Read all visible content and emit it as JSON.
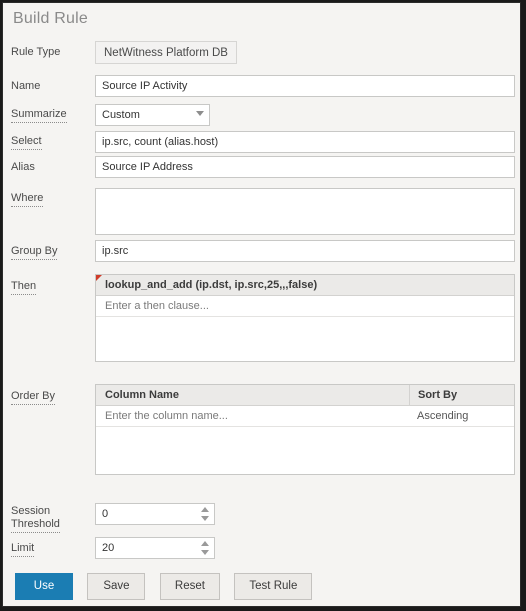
{
  "page": {
    "title": "Build Rule"
  },
  "form": {
    "rule_type": {
      "label": "Rule Type",
      "value": "NetWitness Platform DB"
    },
    "name": {
      "label": "Name",
      "value": "Source IP Activity",
      "placeholder": ""
    },
    "summarize": {
      "label": "Summarize",
      "value": "Custom",
      "options": [
        "Custom"
      ]
    },
    "select": {
      "label": "Select",
      "value": "ip.src, count (alias.host)",
      "placeholder": ""
    },
    "alias": {
      "label": "Alias",
      "value": "Source IP Address",
      "placeholder": ""
    },
    "where": {
      "label": "Where",
      "value": "",
      "placeholder": ""
    },
    "group_by": {
      "label": "Group By",
      "value": "ip.src",
      "placeholder": ""
    },
    "then": {
      "label": "Then",
      "entries": [
        {
          "text": "lookup_and_add (ip.dst, ip.src,25,,,false)",
          "type": "entry"
        }
      ],
      "placeholder": "Enter a then clause..."
    },
    "order_by": {
      "label": "Order By",
      "columns": [
        "Column Name",
        "Sort By"
      ],
      "rows": [
        {
          "column_name": "Enter the column name...",
          "sort_by": "Ascending"
        }
      ]
    },
    "session_threshold": {
      "label": "Session\nThreshold",
      "value": "0"
    },
    "limit": {
      "label": "Limit",
      "value": "20"
    }
  },
  "buttons": {
    "use": "Use",
    "save": "Save",
    "reset": "Reset",
    "test_rule": "Test Rule"
  },
  "colors": {
    "primary": "#1b7db3",
    "page_bg": "#f5f4f2",
    "field_border": "#c8c8c6",
    "header_bg": "#ebeae8",
    "flag_red": "#d03c2a"
  }
}
